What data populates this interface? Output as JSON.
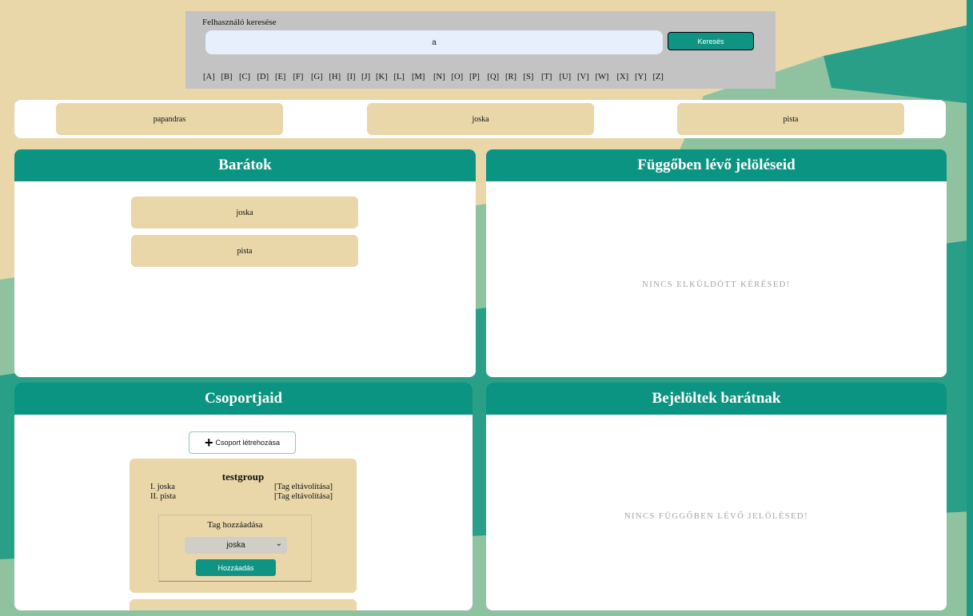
{
  "search": {
    "label": "Felhasználó keresése",
    "value": "a",
    "button_label": "Keresés",
    "letters": [
      "[A]",
      "[B]",
      "[C]",
      "[D]",
      "[E]",
      "[F]",
      "[G]",
      "[H]",
      "[I]",
      "[J]",
      "[K]",
      "[L]",
      "[M]",
      "[N]",
      "[O]",
      "[P]",
      "[Q]",
      "[R]",
      "[S]",
      "[T]",
      "[U]",
      "[V]",
      "[W]",
      "[X]",
      "[Y]",
      "[Z]"
    ]
  },
  "search_results": [
    "papandras",
    "joska",
    "pista"
  ],
  "friends": {
    "title": "Barátok",
    "items": [
      "joska",
      "pista"
    ]
  },
  "pending": {
    "title": "Függőben lévő jelöléseid",
    "empty_message": "NINCS ELKÜLDÖTT KÉRÉSED!"
  },
  "groups": {
    "title": "Csoportjaid",
    "create_label": "Csoport létrehozása",
    "group": {
      "name": "testgroup",
      "members": [
        {
          "name": "I. joska",
          "action": "[Tag eltávolítása]"
        },
        {
          "name": "II. pista",
          "action": "[Tag eltávolítása]"
        }
      ],
      "add_title": "Tag hozzáadása",
      "selected_member": "joska",
      "add_button": "Hozzáadás"
    }
  },
  "incoming": {
    "title": "Bejelöltek barátnak",
    "empty_message": "NINCS FÜGGŐBEN LÉVŐ JELÖLÉSED!"
  },
  "colors": {
    "accent": "#0b9482",
    "card": "#e9d7a9",
    "background_teal": "#2a9f88"
  }
}
